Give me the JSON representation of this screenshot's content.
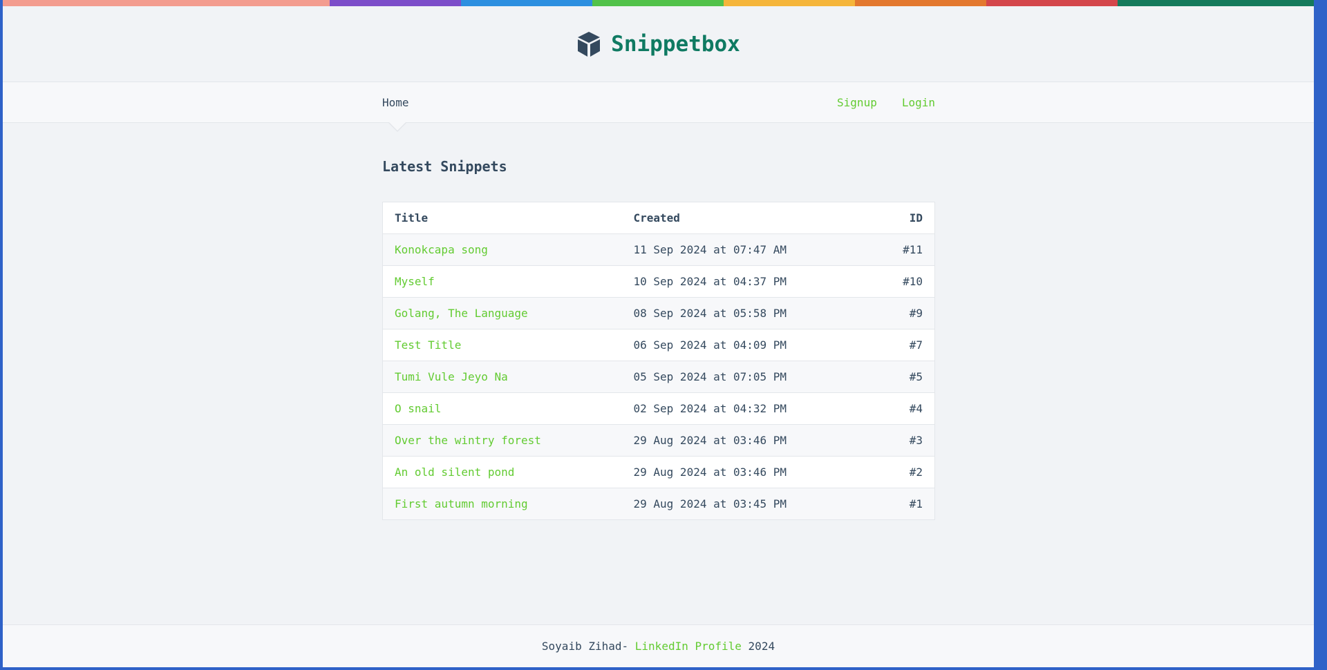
{
  "colors": {
    "brand": "#0f7a62",
    "link": "#62cb31",
    "text": "#34495e",
    "background": "#f1f3f6",
    "rainbow": [
      "#f39c8f",
      "#7c4dc9",
      "#2d8fe0",
      "#52c24a",
      "#f5b53b",
      "#e3782f",
      "#d4464b",
      "#157a5c"
    ]
  },
  "header": {
    "logo_icon": "cube-icon",
    "brand_name": "Snippetbox"
  },
  "nav": {
    "home": "Home",
    "signup": "Signup",
    "login": "Login"
  },
  "main": {
    "section_title": "Latest Snippets",
    "table": {
      "columns": [
        "Title",
        "Created",
        "ID"
      ],
      "rows": [
        {
          "title": "Konokcapa song",
          "created": "11 Sep 2024 at 07:47 AM",
          "id": "#11"
        },
        {
          "title": "Myself",
          "created": "10 Sep 2024 at 04:37 PM",
          "id": "#10"
        },
        {
          "title": "Golang, The Language",
          "created": "08 Sep 2024 at 05:58 PM",
          "id": "#9"
        },
        {
          "title": "Test Title",
          "created": "06 Sep 2024 at 04:09 PM",
          "id": "#7"
        },
        {
          "title": "Tumi Vule Jeyo Na",
          "created": "05 Sep 2024 at 07:05 PM",
          "id": "#5"
        },
        {
          "title": "O snail",
          "created": "02 Sep 2024 at 04:32 PM",
          "id": "#4"
        },
        {
          "title": "Over the wintry forest",
          "created": "29 Aug 2024 at 03:46 PM",
          "id": "#3"
        },
        {
          "title": "An old silent pond",
          "created": "29 Aug 2024 at 03:46 PM",
          "id": "#2"
        },
        {
          "title": "First autumn morning",
          "created": "29 Aug 2024 at 03:45 PM",
          "id": "#1"
        }
      ]
    }
  },
  "footer": {
    "author": "Soyaib Zihad-",
    "link_label": "LinkedIn Profile",
    "year": "2024"
  }
}
